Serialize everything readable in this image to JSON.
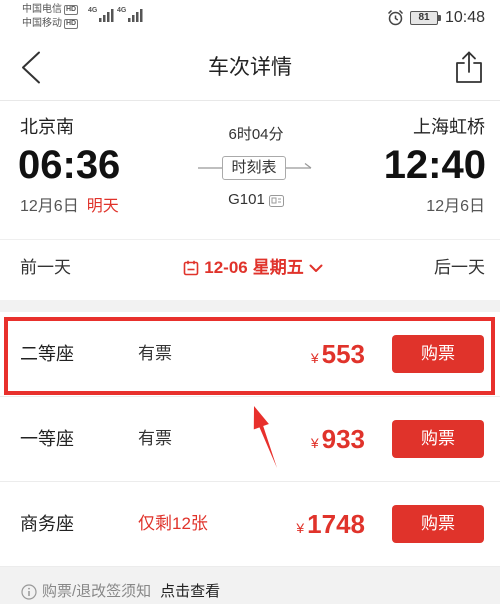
{
  "status_bar": {
    "carriers": [
      {
        "name": "中国电信",
        "badge": "HD",
        "network": "4G"
      },
      {
        "name": "中国移动",
        "badge": "HD",
        "network": "4G"
      }
    ],
    "alarm_icon": "alarm-clock-icon",
    "battery_icon": "battery-icon",
    "battery_level": "81",
    "time": "10:48"
  },
  "header": {
    "back_icon": "chevron-left-icon",
    "title": "车次详情",
    "share_icon": "share-icon"
  },
  "trip": {
    "departure": {
      "station": "北京南",
      "time": "06:36",
      "date": "12月6日",
      "day_tag": "明天"
    },
    "duration": "6时04分",
    "timetable_label": "时刻表",
    "train_number": "G101",
    "train_number_icon": "id-card-icon",
    "arrival": {
      "station": "上海虹桥",
      "time": "12:40",
      "date": "12月6日"
    }
  },
  "date_nav": {
    "prev_label": "前一天",
    "calendar_icon": "calendar-icon",
    "current_date": "12-06",
    "current_weekday": "星期五",
    "dropdown_icon": "chevron-down-icon",
    "next_label": "后一天"
  },
  "seats": [
    {
      "class": "二等座",
      "availability": "有票",
      "currency": "¥",
      "price": "553",
      "buy_label": "购票",
      "highlighted": true
    },
    {
      "class": "一等座",
      "availability": "有票",
      "currency": "¥",
      "price": "933",
      "buy_label": "购票"
    },
    {
      "class": "商务座",
      "availability": "仅剩12张",
      "availability_warning": true,
      "currency": "¥",
      "price": "1748",
      "buy_label": "购票"
    }
  ],
  "footer": {
    "info_icon": "info-circle-icon",
    "notice": "购票/退改签须知",
    "link_label": "点击查看"
  },
  "colors": {
    "accent": "#e0332b",
    "text_primary": "#222222",
    "text_secondary": "#666666",
    "page_gray": "#f2f2f2",
    "annotation": "#e8302c"
  }
}
